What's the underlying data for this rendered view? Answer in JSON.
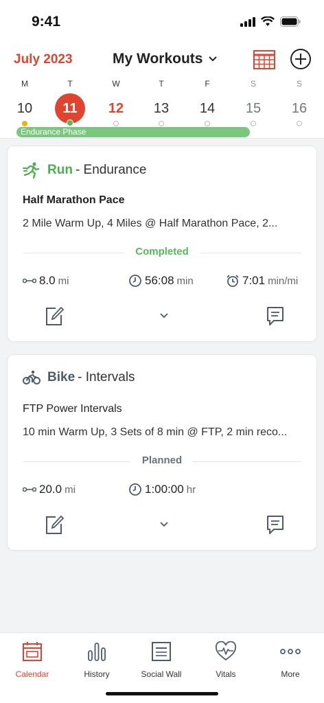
{
  "status_bar": {
    "time": "9:41"
  },
  "header": {
    "month": "July 2023",
    "title": "My Workouts",
    "icons": {
      "calendar_grid": "calendar-grid-icon",
      "add": "plus-circle-icon",
      "dropdown": "chevron-down-icon"
    }
  },
  "week": {
    "days": [
      {
        "letter": "M",
        "num": "10"
      },
      {
        "letter": "T",
        "num": "11"
      },
      {
        "letter": "W",
        "num": "12"
      },
      {
        "letter": "T",
        "num": "13"
      },
      {
        "letter": "F",
        "num": "14"
      },
      {
        "letter": "S",
        "num": "15"
      },
      {
        "letter": "S",
        "num": "16"
      }
    ],
    "phase": "Endurance Phase"
  },
  "workouts": [
    {
      "sport": "Run",
      "subtitle": "- Endurance",
      "title": "Half Marathon Pace",
      "description": "2 Mile Warm Up, 4 Miles @ Half Marathon Pace, 2...",
      "status": "Completed",
      "distance": "8.0",
      "distance_unit": "mi",
      "duration": "56:08",
      "duration_unit": "min",
      "pace": "7:01",
      "pace_unit": "min/mi"
    },
    {
      "sport": "Bike",
      "subtitle": "- Intervals",
      "title": "FTP Power Intervals",
      "description": "10 min Warm Up, 3 Sets of 8 min @ FTP, 2 min reco...",
      "status": "Planned",
      "distance": "20.0",
      "distance_unit": "mi",
      "duration": "1:00:00",
      "duration_unit": "hr"
    }
  ],
  "tabs": [
    {
      "label": "Calendar"
    },
    {
      "label": "History"
    },
    {
      "label": "Social Wall"
    },
    {
      "label": "Vitals"
    },
    {
      "label": "More"
    }
  ],
  "colors": {
    "accent": "#e0442f",
    "run": "#4cb050",
    "phase": "#7bc77e",
    "completed": "#56b95a"
  }
}
